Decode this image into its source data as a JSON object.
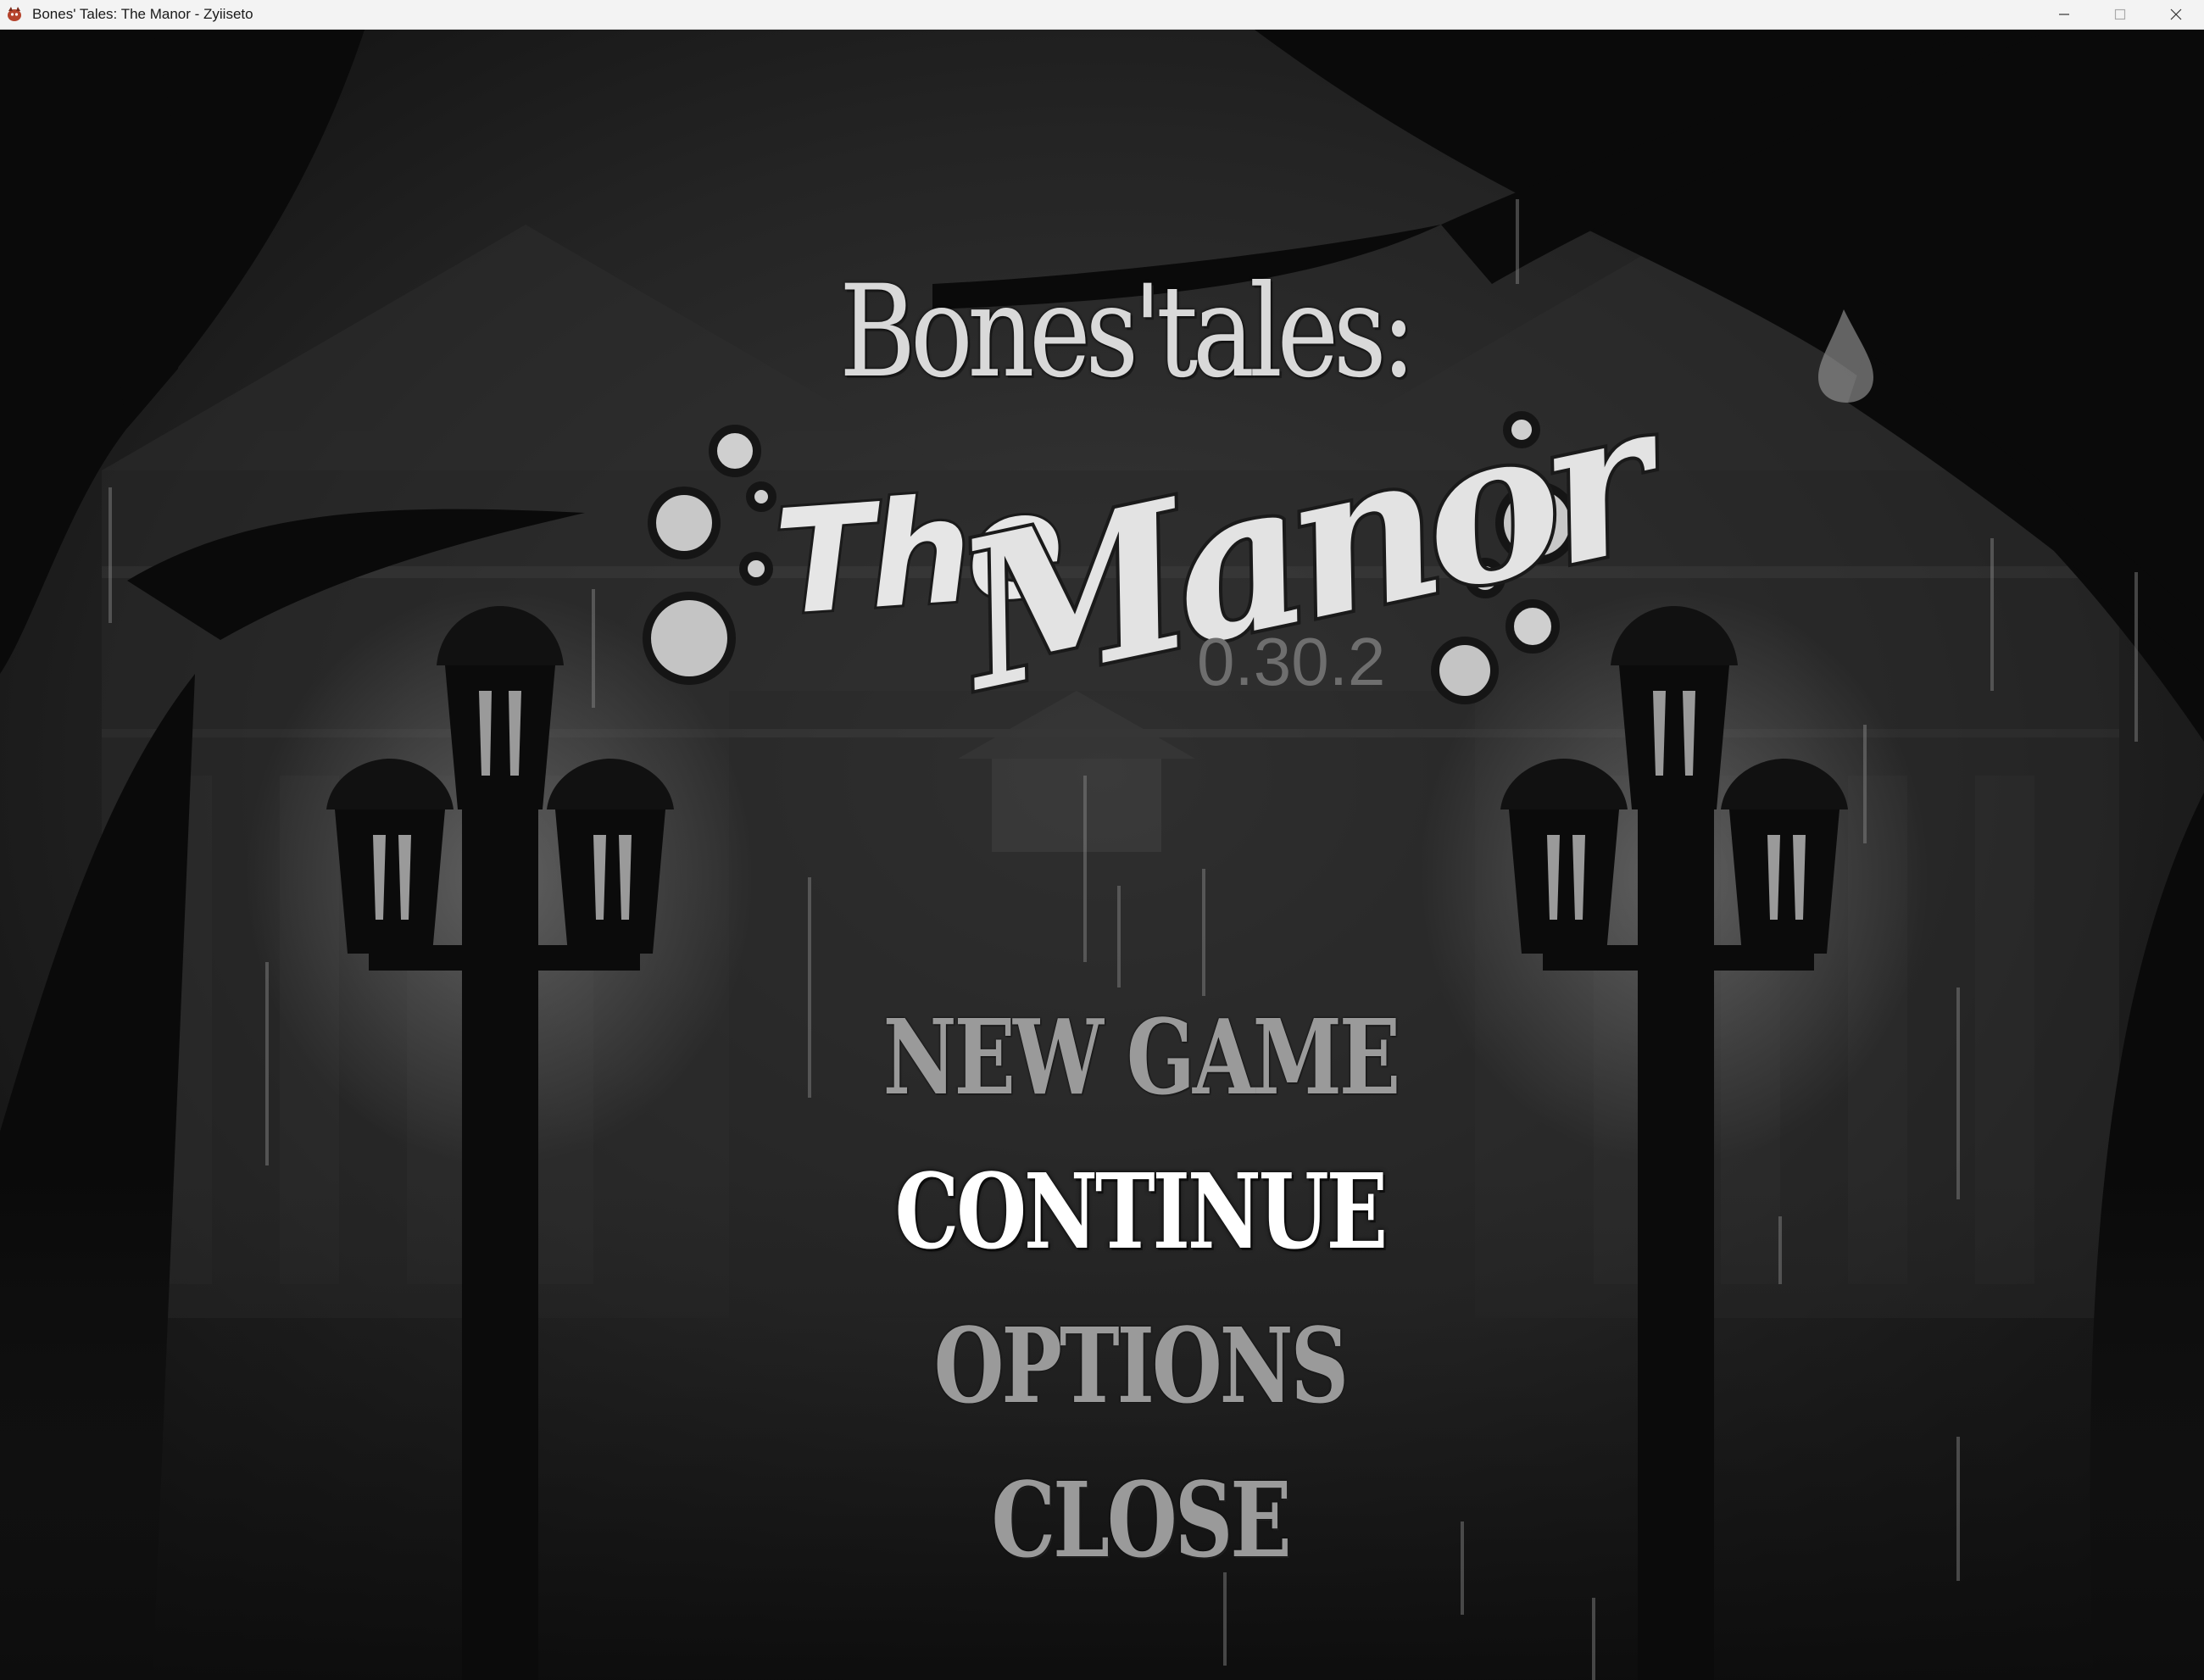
{
  "window": {
    "title": "Bones' Tales: The Manor - Zyiiseto",
    "icon": "app-icon",
    "controls": [
      "minimize-icon",
      "maximize-icon",
      "close-icon"
    ]
  },
  "logo": {
    "line1": "Bones'tales:",
    "the": "The",
    "manor": "Manor",
    "version": "0.30.2"
  },
  "menu": {
    "items": [
      {
        "label": "NEW GAME",
        "selected": false
      },
      {
        "label": "CONTINUE",
        "selected": true
      },
      {
        "label": "OPTIONS",
        "selected": false
      },
      {
        "label": "CLOSE",
        "selected": false
      }
    ]
  },
  "colors": {
    "titlebar": "#f3f3f3",
    "background": "#1b1b1b",
    "menu_dim": "#9a9a9a",
    "menu_selected": "#ffffff",
    "version": "#6e6e6e"
  }
}
